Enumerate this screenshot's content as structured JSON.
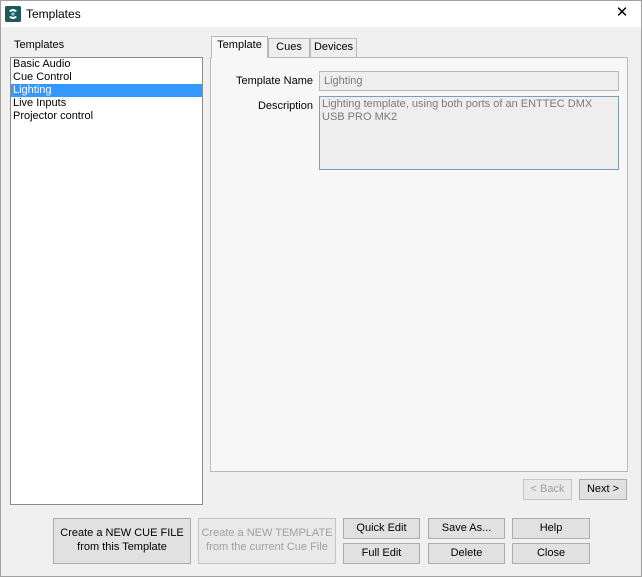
{
  "window": {
    "title": "Templates",
    "icon": "app-logo-icon",
    "close_glyph": "✕"
  },
  "templates": {
    "label": "Templates",
    "items": [
      "Basic Audio",
      "Cue Control",
      "Lighting",
      "Live Inputs",
      "Projector control"
    ],
    "selected_index": 2
  },
  "tabs": [
    {
      "label": "Template",
      "active": true
    },
    {
      "label": "Cues",
      "active": false
    },
    {
      "label": "Devices",
      "active": false
    }
  ],
  "template_tab": {
    "name_label": "Template Name",
    "name_value": "Lighting",
    "description_label": "Description",
    "description_value": "Lighting template, using both ports of an ENTTEC DMX USB PRO MK2"
  },
  "nav": {
    "back_label": "< Back",
    "next_label": "Next >"
  },
  "actions": {
    "create_cue_file_line1": "Create a NEW CUE FILE",
    "create_cue_file_line2": "from this Template",
    "create_template_line1": "Create a NEW TEMPLATE",
    "create_template_line2": "from the current Cue File",
    "quick_edit": "Quick Edit",
    "full_edit": "Full Edit",
    "save_as": "Save As...",
    "delete": "Delete",
    "help": "Help",
    "close": "Close"
  }
}
